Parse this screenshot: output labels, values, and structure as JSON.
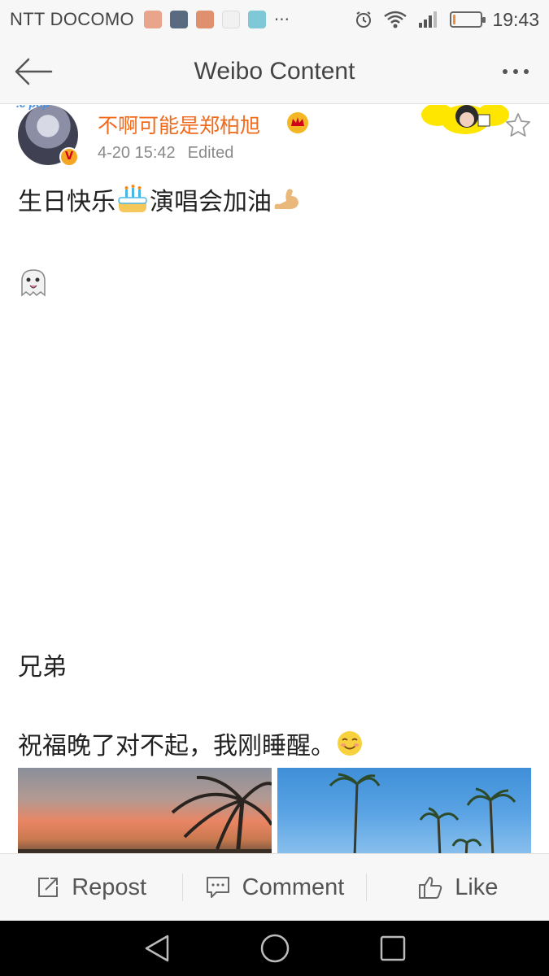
{
  "status_bar": {
    "carrier": "NTT DOCOMO",
    "notification_more": "···",
    "time": "19:43",
    "battery_level": 0.08
  },
  "header": {
    "title": "Weibo Content"
  },
  "post": {
    "avatar_tag": ".c pop",
    "username": "不啊可能是郑柏旭",
    "date": "4-20 15:42",
    "edited": "Edited",
    "text_line1_a": "生日快乐",
    "text_line1_b": "演唱会加油",
    "text_line3": "兄弟",
    "text_line4": "祝福晚了对不起，我刚睡醒。"
  },
  "actions": {
    "repost": "Repost",
    "comment": "Comment",
    "like": "Like"
  },
  "colors": {
    "username": "#f06a1c",
    "meta": "#8a8a8a",
    "bar_bg": "#f7f7f7"
  }
}
